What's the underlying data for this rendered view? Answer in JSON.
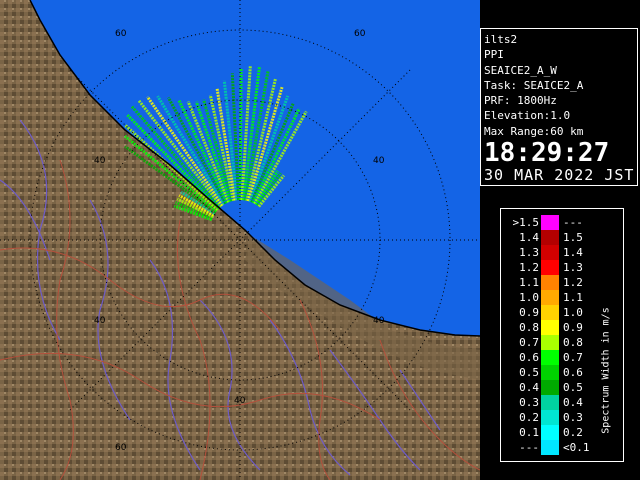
{
  "header": {
    "site": "ilts2",
    "product": "PPI",
    "scan": "SEAICE2_A_W",
    "task": "Task: SEAICE2_A",
    "prf": "PRF: 1800Hz",
    "elevation": "Elevation:1.0",
    "max_range": "Max Range:60 km",
    "time": "18:29:27",
    "date": "30 MAR 2022 JST"
  },
  "range_labels": [
    "60",
    "60",
    "40",
    "40",
    "40",
    "40",
    "40",
    "60"
  ],
  "legend": {
    "unit_label": "Spectrum Width in m/s",
    "rows": [
      {
        "lo": ">1.5",
        "hi": "---",
        "color": "#ff00ff"
      },
      {
        "lo": "1.4",
        "hi": "1.5",
        "color": "#b40000"
      },
      {
        "lo": "1.3",
        "hi": "1.4",
        "color": "#d20000"
      },
      {
        "lo": "1.2",
        "hi": "1.3",
        "color": "#ff0000"
      },
      {
        "lo": "1.1",
        "hi": "1.2",
        "color": "#ff8200"
      },
      {
        "lo": "1.0",
        "hi": "1.1",
        "color": "#ffaa00"
      },
      {
        "lo": "0.9",
        "hi": "1.0",
        "color": "#ffd200"
      },
      {
        "lo": "0.8",
        "hi": "0.9",
        "color": "#ffff00"
      },
      {
        "lo": "0.7",
        "hi": "0.8",
        "color": "#aaff00"
      },
      {
        "lo": "0.6",
        "hi": "0.7",
        "color": "#00ff00"
      },
      {
        "lo": "0.5",
        "hi": "0.6",
        "color": "#00d200"
      },
      {
        "lo": "0.4",
        "hi": "0.5",
        "color": "#00aa00"
      },
      {
        "lo": "0.3",
        "hi": "0.4",
        "color": "#00d2a0"
      },
      {
        "lo": "0.2",
        "hi": "0.3",
        "color": "#00e6d2"
      },
      {
        "lo": "0.1",
        "hi": "0.2",
        "color": "#00ffff"
      },
      {
        "lo": "---",
        "hi": "<0.1",
        "color": "#00e6ff"
      }
    ]
  },
  "colors": {
    "sea": "#1464e6",
    "land": "#7a6446",
    "river": "#6e5cc8",
    "boundary": "#b4503c"
  }
}
